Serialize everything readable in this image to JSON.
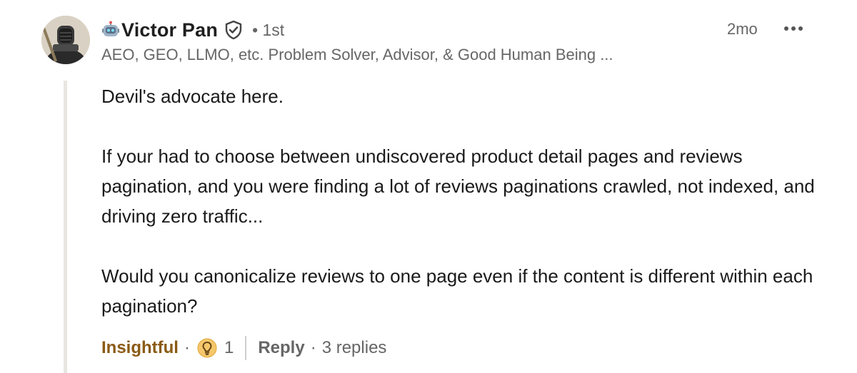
{
  "author": {
    "name": "Victor Pan",
    "name_prefix_icon": "robot-emoji",
    "badge_icon": "verified-shield-icon",
    "degree": "• 1st",
    "headline": "AEO, GEO, LLMO, etc. Problem Solver, Advisor, & Good Human Being ..."
  },
  "timestamp": "2mo",
  "menu_icon": "more-options-icon",
  "body": {
    "paragraphs": [
      "Devil's advocate here.",
      "If your had to choose between undiscovered product detail pages and reviews pagination, and you were finding a lot of reviews paginations crawled, not indexed, and driving zero traffic...",
      "Would you canonicalize reviews to one page even if the content is different within each pagination?"
    ]
  },
  "actions": {
    "reaction_label": "Insightful",
    "separator": "·",
    "reaction_icon": "lightbulb-icon",
    "reaction_count": "1",
    "reply_label": "Reply",
    "replies_text": "3 replies"
  },
  "colors": {
    "reaction_accent": "#8a5a14",
    "secondary_text": "#666666",
    "thread_line": "#e8e6e1"
  }
}
